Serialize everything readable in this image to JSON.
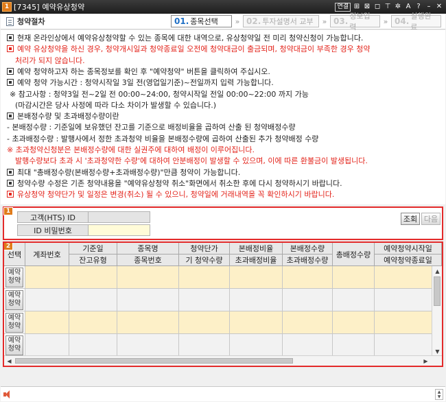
{
  "window": {
    "badge": "1",
    "title": "[7345] 예약유상청약",
    "link_button": "연결",
    "controls": [
      {
        "name": "pin-icon",
        "glyph": "⊞"
      },
      {
        "name": "memo-icon",
        "glyph": "⊠"
      },
      {
        "name": "print-icon",
        "glyph": "◻"
      },
      {
        "name": "tack-icon",
        "glyph": "⊤"
      },
      {
        "name": "settings-icon",
        "glyph": "✲"
      },
      {
        "name": "font-size-icon",
        "glyph": "A"
      },
      {
        "name": "help-icon",
        "glyph": "?"
      },
      {
        "name": "minimize-icon",
        "glyph": "–"
      },
      {
        "name": "close-icon",
        "glyph": "✕"
      }
    ]
  },
  "steps_header": {
    "title": "청약절차",
    "steps": [
      {
        "num": "01.",
        "label": "종목선택",
        "active": true
      },
      {
        "num": "02.",
        "label": "투자설명서 교부",
        "active": false
      },
      {
        "num": "03.",
        "label": "정보입력",
        "active": false
      },
      {
        "num": "04.",
        "label": "실행완료",
        "active": false
      }
    ]
  },
  "notices": [
    {
      "text": "현재 온라인상에서 예약유상청약할 수 있는 종목에 대한 내역으로, 유상청약일 전 미리 청약신청이 가능합니다.",
      "bullet": true,
      "red": false
    },
    {
      "text": "예약 유상청약을 하신 경우, 청약개시일과 청약종료일 오전에 청약대금이 출금되며, 청약대금이 부족한 경우 청약",
      "bullet": true,
      "red": true
    },
    {
      "text": "처리가 되지 않습니다.",
      "bullet": false,
      "red": true,
      "indent": 12
    },
    {
      "text": "예약 청약하고자 하는 종목정보를 확인 후 \"예약청약\" 버튼을 클릭하여 주십시오.",
      "bullet": true,
      "red": false
    },
    {
      "text": "예약 청약 가능시간 : 청약시작일 3일 전(영업일기준)~전일까지 입력 가능합니다.",
      "bullet": true,
      "red": false
    },
    {
      "text": "※ 참고사항 : 청약3일 전~2일 전 00:00~24:00, 청약시작일 전일 00:00~22:00 까지 가능",
      "bullet": false,
      "red": false,
      "indent": 4
    },
    {
      "text": "(마감시간은 당사 사정에 따라 다소 차이가 발생할 수 있습니다.)",
      "bullet": false,
      "red": false,
      "indent": 12
    },
    {
      "text": "본배정수량 및 초과배정수량이란",
      "bullet": true,
      "red": false
    },
    {
      "text": "- 본배정수량 : 기준일에 보유했던 잔고를 기준으로 배정비율을 곱하여 산출 된 청약배정수량",
      "bullet": false,
      "red": false
    },
    {
      "text": "- 초과배정수량 : 발행사에서 정한 초과청약 비율을 본배정수량에 곱하여 산출된 추가 청약배정 수량",
      "bullet": false,
      "red": false
    },
    {
      "text": "※ 초과청약신청분은 본배정수량에 대한 실권주에 대하여 배정이 이루어집니다.",
      "bullet": false,
      "red": true
    },
    {
      "text": "발행수량보다 초과 시 '초과청약한 수량'에 대하여 안분배정이 발생할 수 있으며, 이에 따른 환불금이 발생됩니다.",
      "bullet": false,
      "red": true,
      "indent": 12
    },
    {
      "text": "최대 \"총배정수량(본배정수량+초과배정수량)\"만큼 청약이 가능합니다.",
      "bullet": true,
      "red": false
    },
    {
      "text": "청약수량 수정은  기존 청약내용을 \"예약유상청약 취소\"화면에서 취소한 후에 다시 청약하시기 바랍니다.",
      "bullet": true,
      "red": false
    },
    {
      "text": "유상청약 청약단가 및 일정은 변경(취소) 될 수 있으니, 청약일에 거래내역을 꼭 확인하시기 바랍니다.",
      "bullet": true,
      "red": true
    }
  ],
  "section1": {
    "badge": "1",
    "customer_id_label": "고객(HTS) ID",
    "customer_id_value": "",
    "id_password_label": "ID 비밀번호",
    "id_password_value": "",
    "query_button": "조회",
    "next_button": "다음"
  },
  "section2": {
    "badge": "2",
    "columns": [
      {
        "top": "선택",
        "bottom": ""
      },
      {
        "top": "계좌번호",
        "bottom": ""
      },
      {
        "top": "기준일",
        "bottom": "잔고유형"
      },
      {
        "top": "종목명",
        "bottom": "종목번호"
      },
      {
        "top": "청약단가",
        "bottom": "기 청약수량"
      },
      {
        "top": "본배정비율",
        "bottom": "초과배정비율"
      },
      {
        "top": "본배정수량",
        "bottom": "초과배정수량"
      },
      {
        "top": "총배정수량",
        "bottom": ""
      },
      {
        "top": "예약청약시작일",
        "bottom": "예약청약종료일"
      }
    ],
    "select_button": "예약\n청약",
    "row_count": 4
  },
  "colors": {
    "accent_red": "#e32a2a",
    "notice_red": "#e3231a",
    "row_highlight": "#fdf0c8",
    "password_field": "#fffbd8",
    "badge_orange": "#e07b1a"
  }
}
